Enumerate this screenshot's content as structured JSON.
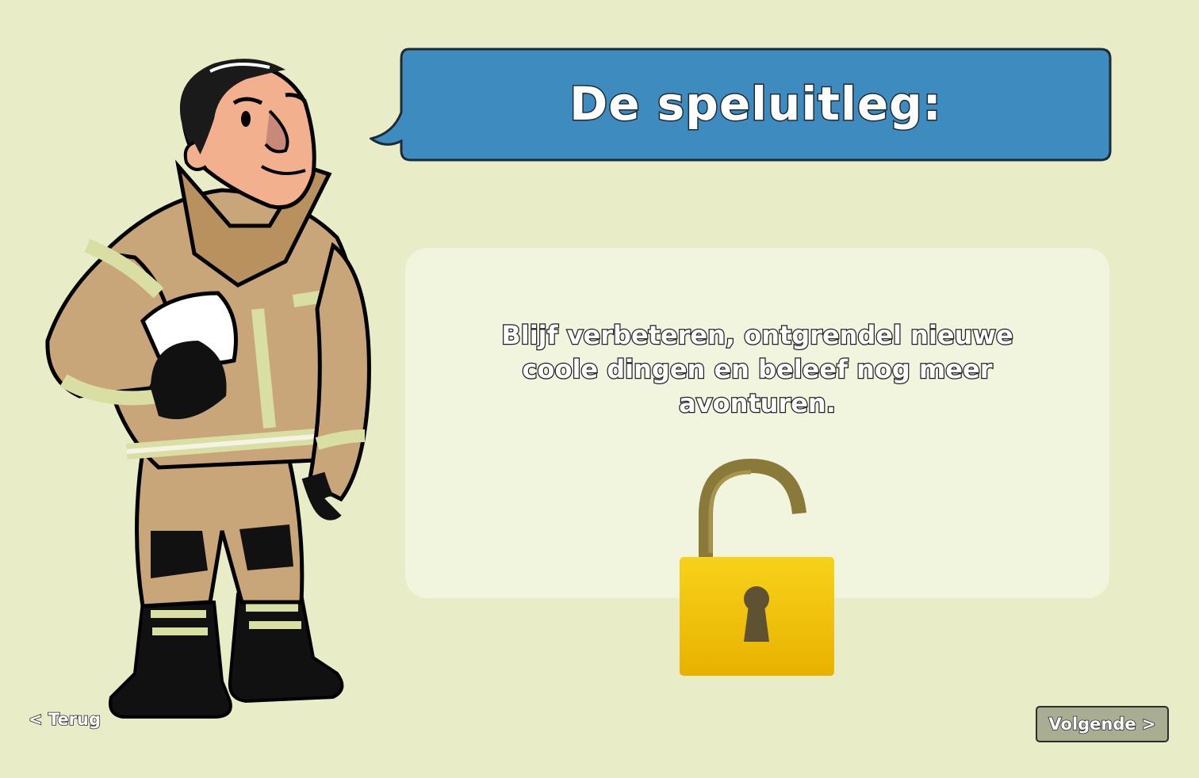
{
  "header": {
    "title": "De speluitleg:"
  },
  "content": {
    "text": "Blijf verbeteren, ontgrendel nieuwe coole dingen en beleef nog meer avonturen."
  },
  "navigation": {
    "back_label": "< Terug",
    "next_label": "Volgende >"
  },
  "colors": {
    "background": "#e9edc7",
    "bubble": "#3e8bbf",
    "panel": "#f1f5dd",
    "lock_body": "#f2c300",
    "lock_shackle": "#8a7a3a",
    "button": "#a9ad92"
  },
  "icons": {
    "character": "firefighter-character",
    "lock": "unlocked-padlock-icon"
  }
}
